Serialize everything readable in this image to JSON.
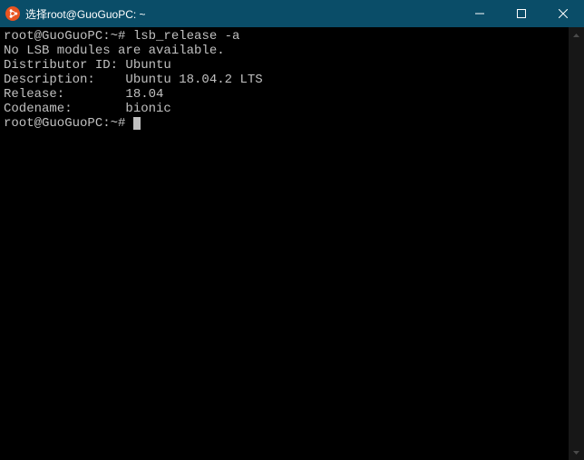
{
  "titlebar": {
    "title": "选择root@GuoGuoPC: ~"
  },
  "terminal": {
    "lines": [
      {
        "prompt": "root@GuoGuoPC:~# ",
        "cmd": "lsb_release -a"
      },
      {
        "text": "No LSB modules are available."
      },
      {
        "text": "Distributor ID: Ubuntu"
      },
      {
        "text": "Description:    Ubuntu 18.04.2 LTS"
      },
      {
        "text": "Release:        18.04"
      },
      {
        "text": "Codename:       bionic"
      },
      {
        "prompt": "root@GuoGuoPC:~# ",
        "cursor": true
      }
    ]
  }
}
